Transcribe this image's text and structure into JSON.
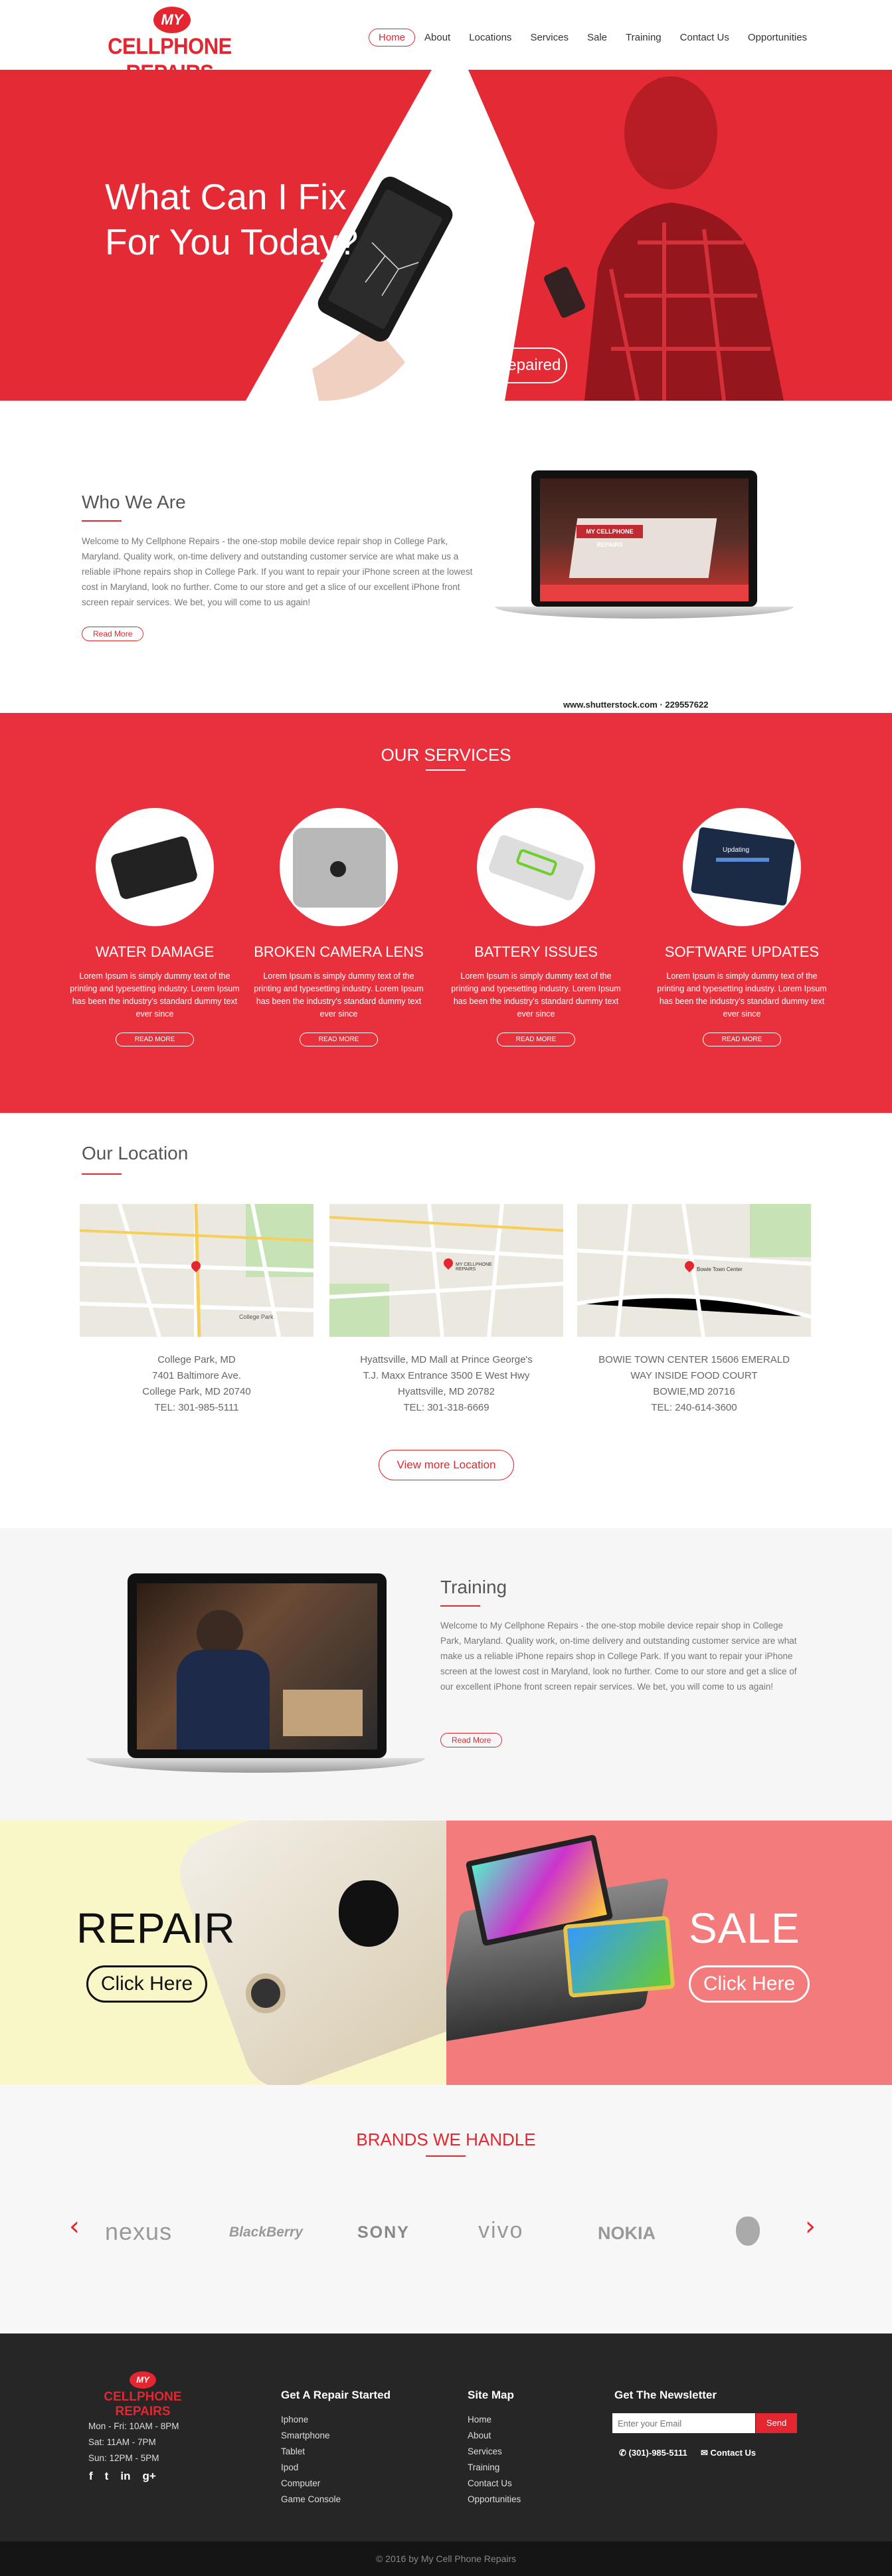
{
  "header": {
    "logo_my": "MY",
    "logo_name": "CELLPHONE REPAIRS",
    "nav": [
      "Home",
      "About",
      "Locations",
      "Services",
      "Sale",
      "Training",
      "Contact Us",
      "Opportunities"
    ]
  },
  "hero": {
    "headline_1": "What Can I Fix",
    "headline_2": "For You Today?",
    "cta": "Get Repaired"
  },
  "who": {
    "title": "Who We Are",
    "text": "Welcome to My Cellphone Repairs - the one-stop mobile device repair shop in College Park, Maryland. Quality work, on-time delivery and outstanding customer service are what make us a reliable iPhone repairs shop in College Park. If you want to repair your iPhone screen at the lowest cost in Maryland, look no further. Come to our store and get a slice of our excellent iPhone front screen repair services. We bet, you will come to us again!",
    "button": "Read More",
    "watermark": "www.shutterstock.com · 229557622",
    "kiosk_sign": "MY CELLPHONE REPAIRS"
  },
  "services": {
    "title": "OUR SERVICES",
    "items": [
      {
        "title": "WATER DAMAGE",
        "text": "Lorem Ipsum is simply dummy text of the printing and typesetting industry. Lorem Ipsum has been the industry's standard dummy text ever since",
        "button": "READ MORE"
      },
      {
        "title": "BROKEN CAMERA LENS",
        "text": "Lorem Ipsum is simply dummy text of the printing and typesetting industry. Lorem Ipsum has been the industry's standard dummy text ever since",
        "button": "READ MORE"
      },
      {
        "title": "BATTERY ISSUES",
        "text": "Lorem Ipsum is simply dummy text of the printing and typesetting industry. Lorem Ipsum has been the industry's standard dummy text ever since",
        "button": "READ MORE"
      },
      {
        "title": "SOFTWARE UPDATES",
        "text": "Lorem Ipsum is simply dummy text of the printing and typesetting industry. Lorem Ipsum has been the industry's standard dummy text ever since",
        "button": "READ MORE"
      }
    ],
    "phone_screen": "Updating"
  },
  "location": {
    "title": "Our Location",
    "items": [
      {
        "l1": "College Park, MD",
        "l2": "7401 Baltimore Ave.",
        "l3": "College Park, MD 20740",
        "l4": "TEL: 301-985-5111",
        "pin": "College Park"
      },
      {
        "l1": "Hyattsville, MD Mall at Prince George's",
        "l2": "T.J. Maxx Entrance 3500 E West Hwy",
        "l3": "Hyattsville, MD 20782",
        "l4": "TEL: 301-318-6669",
        "pin": "MY CELLPHONE REPAIRS"
      },
      {
        "l1": "BOWIE TOWN CENTER 15606 EMERALD",
        "l2": "WAY INSIDE FOOD COURT",
        "l3": "BOWIE,MD 20716",
        "l4": "TEL: 240-614-3600",
        "pin": "Bowie Town Center"
      }
    ],
    "button": "View more Location"
  },
  "training": {
    "title": "Training",
    "text": "Welcome to My Cellphone Repairs - the one-stop mobile device repair shop in College Park, Maryland. Quality work, on-time delivery and outstanding customer service are what make us a reliable iPhone repairs shop in College Park. If you want to repair your iPhone screen at the lowest cost in Maryland, look no further. Come to our store and get a slice of our excellent iPhone front screen repair services. We bet, you will come to us again!",
    "button": "Read More"
  },
  "promo": {
    "repair_title": "REPAIR",
    "repair_btn": "Click Here",
    "sale_title": "SALE",
    "sale_btn": "Click Here"
  },
  "brands": {
    "title": "BRANDS WE HANDLE",
    "items": [
      "nexus",
      "BlackBerry",
      "SONY",
      "vivo",
      "NOKIA"
    ]
  },
  "footer": {
    "logo_my": "MY",
    "logo_name": "CELLPHONE REPAIRS",
    "hours": [
      "Mon - Fri: 10AM - 8PM",
      "Sat: 11AM - 7PM",
      "Sun: 12PM - 5PM"
    ],
    "col1_title": "Get A Repair Started",
    "col1": [
      "Iphone",
      "Smartphone",
      "Tablet",
      "Ipod",
      "Computer",
      "Game Console"
    ],
    "col2_title": "Site Map",
    "col2": [
      "Home",
      "About",
      "Services",
      "Training",
      "Contact Us",
      "Opportunities"
    ],
    "col3_title": "Get The Newsletter",
    "email_placeholder": "Enter your Email",
    "send": "Send",
    "phone": "(301)-985-5111",
    "contact": "Contact Us",
    "copyright": "© 2016 by My Cell Phone Repairs"
  }
}
